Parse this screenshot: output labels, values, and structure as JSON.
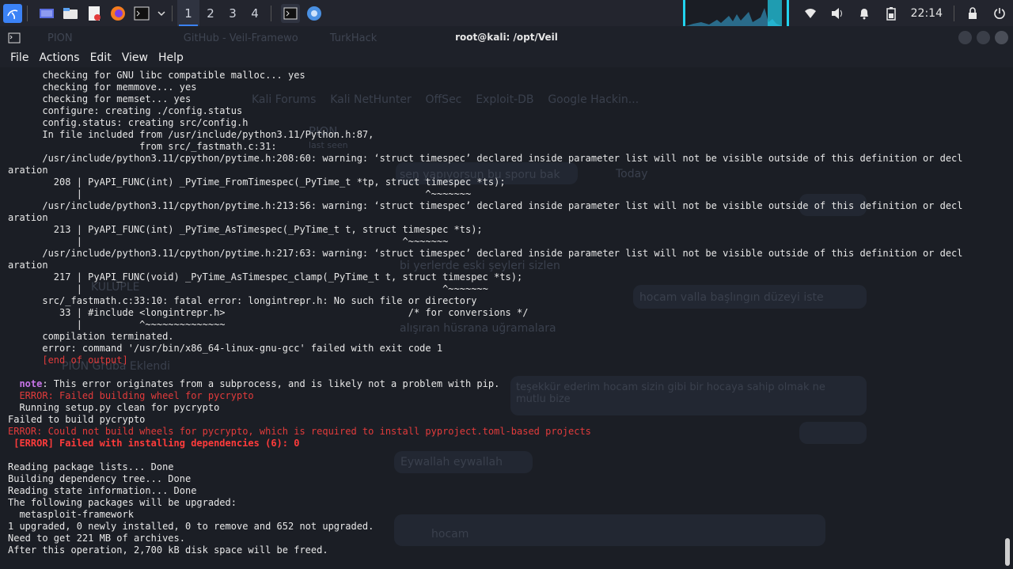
{
  "taskbar": {
    "apps": [
      "kali-menu-icon",
      "desktop-icon",
      "file-manager-icon",
      "text-editor-icon",
      "firefox-icon",
      "terminal-icon",
      "chevron-down-icon"
    ],
    "workspaces": [
      "1",
      "2",
      "3",
      "4"
    ],
    "active_workspace": 0,
    "running_apps": [
      "terminal-icon",
      "chromium-icon"
    ],
    "tray_icons": [
      "wifi-icon",
      "volume-icon",
      "notification-icon",
      "battery-icon",
      "lock-icon",
      "power-icon"
    ],
    "clock": "22:14"
  },
  "window": {
    "title": "root@kali: /opt/Veil"
  },
  "menu": [
    "File",
    "Actions",
    "Edit",
    "View",
    "Help"
  ],
  "terminal_lines": [
    {
      "t": "      checking for GNU libc compatible malloc... yes"
    },
    {
      "t": "      checking for memmove... yes"
    },
    {
      "t": "      checking for memset... yes"
    },
    {
      "t": "      configure: creating ./config.status"
    },
    {
      "t": "      config.status: creating src/config.h"
    },
    {
      "t": "      In file included from /usr/include/python3.11/Python.h:87,"
    },
    {
      "t": "                       from src/_fastmath.c:31:"
    },
    {
      "t": "      /usr/include/python3.11/cpython/pytime.h:208:60: warning: ‘struct timespec’ declared inside parameter list will not be visible outside of this definition or decl"
    },
    {
      "t": "aration"
    },
    {
      "t": "        208 | PyAPI_FUNC(int) _PyTime_FromTimespec(_PyTime_t *tp, struct timespec *ts);"
    },
    {
      "t": "            |                                                            ^~~~~~~~"
    },
    {
      "t": "      /usr/include/python3.11/cpython/pytime.h:213:56: warning: ‘struct timespec’ declared inside parameter list will not be visible outside of this definition or decl"
    },
    {
      "t": "aration"
    },
    {
      "t": "        213 | PyAPI_FUNC(int) _PyTime_AsTimespec(_PyTime_t t, struct timespec *ts);"
    },
    {
      "t": "            |                                                        ^~~~~~~~"
    },
    {
      "t": "      /usr/include/python3.11/cpython/pytime.h:217:63: warning: ‘struct timespec’ declared inside parameter list will not be visible outside of this definition or decl"
    },
    {
      "t": "aration"
    },
    {
      "t": "        217 | PyAPI_FUNC(void) _PyTime_AsTimespec_clamp(_PyTime_t t, struct timespec *ts);"
    },
    {
      "t": "            |                                                               ^~~~~~~~"
    },
    {
      "t": "      src/_fastmath.c:33:10: fatal error: longintrepr.h: No such file or directory"
    },
    {
      "t": "         33 | #include <longintrepr.h>                                /* for conversions */"
    },
    {
      "t": "            |          ^~~~~~~~~~~~~~~"
    },
    {
      "t": "      compilation terminated."
    },
    {
      "t": "      error: command '/usr/bin/x86_64-linux-gnu-gcc' failed with exit code 1"
    },
    {
      "t": "      [end of output]",
      "c": "red"
    },
    {
      "t": ""
    },
    {
      "t": "  ",
      "note": "note",
      "rest": ": This error originates from a subprocess, and is likely not a problem with pip."
    },
    {
      "t": "  ERROR: Failed building wheel for pycrypto",
      "c": "red"
    },
    {
      "t": "  Running setup.py clean for pycrypto"
    },
    {
      "t": "Failed to build pycrypto"
    },
    {
      "t": "ERROR: Could not build wheels for pycrypto, which is required to install pyproject.toml-based projects",
      "c": "red"
    },
    {
      "t": " [ERROR] Failed with installing dependencies (6): 0",
      "c": "red-bold"
    },
    {
      "t": ""
    },
    {
      "t": "Reading package lists... Done"
    },
    {
      "t": "Building dependency tree... Done"
    },
    {
      "t": "Reading state information... Done"
    },
    {
      "t": "The following packages will be upgraded:"
    },
    {
      "t": "  metasploit-framework"
    },
    {
      "t": "1 upgraded, 0 newly installed, 0 to remove and 652 not upgraded."
    },
    {
      "t": "Need to get 221 MB of archives."
    },
    {
      "t": "After this operation, 2,700 kB disk space will be freed."
    }
  ],
  "background_ghost": {
    "tabs": [
      "PION",
      "GitHub - Veil-Framewo",
      "TurkHack"
    ],
    "bookmarks": [
      "Kali Forums",
      "Kali NetHunter",
      "OffSec",
      "Exploit-DB",
      "Google Hackin..."
    ],
    "chat_name": "PION",
    "chat_status": "last seen",
    "day_label": "Today",
    "messages": [
      "sen yapıyorsun bu sporu bak",
      "hoca bilgiler geldi",
      "bi yerlerde eski şeyleri sizlen",
      "hocam valla başlıngın düzeyi iste",
      "alışıran hüsrana uğramalara",
      "teşekkür ederim hocam sizin gibi bir hocaya sahip olmak ne mutlu bize",
      "Eywallah eywallah",
      "hocam"
    ],
    "contacts": [
      "KULÜPLE",
      "PION Gruba Eklendi"
    ]
  }
}
